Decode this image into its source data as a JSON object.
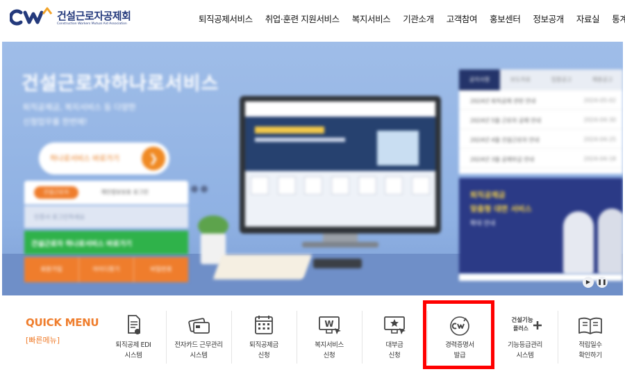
{
  "header": {
    "logo_text": "건설근로자공제회",
    "logo_sub": "Construction Workers Mutual Aid Association",
    "nav": [
      "퇴직공제서비스",
      "취업·훈련 지원서비스",
      "복지서비스",
      "기관소개",
      "고객참여",
      "홍보센터",
      "정보공개",
      "자료실",
      "통계"
    ]
  },
  "hero": {
    "title": "건설근로자하나로서비스",
    "desc_line1": "퇴직공제금, 복지서비스 등 다양한",
    "desc_line2": "신청업무를 한번에!",
    "pill_label": "하나로서비스 바로가기",
    "pill_arrow": "❯",
    "login_tab": "건설근로자",
    "login_option": "개인정보보호 로그인",
    "login_placeholder": "인증서 로그인하세요",
    "green_label": "건설근로자 하나로서비스 바로가기",
    "orange_buttons": [
      "회원가입",
      "아이디찾기",
      "비밀번호"
    ],
    "notice_tabs": [
      "공지사항",
      "보도자료",
      "입찰공고",
      "채용공고"
    ],
    "notices": [
      {
        "title": "2024년 퇴직공제 관련 안내",
        "date": "2024-05-02"
      },
      {
        "title": "2024년 5월 근로자 공제 안내",
        "date": "2024-04-30"
      },
      {
        "title": "2024년 4월 건설근로자 안내",
        "date": "2024-04-25"
      },
      {
        "title": "2024년 3월 공제부금 안내",
        "date": "2024-04-18"
      }
    ],
    "promo_line1": "퇴직공제금",
    "promo_line2": "맞춤형 대면 서비스",
    "promo_line3": "확대 안내",
    "play_icon": "▶",
    "pause_icon": "❚❚"
  },
  "quick_menu": {
    "title": "QUICK MENU",
    "subtitle": "[빠른메뉴]",
    "items": [
      {
        "line1": "퇴직공제 EDI",
        "line2": "시스템",
        "icon": "document-edit-icon"
      },
      {
        "line1": "전자카드 근무관리",
        "line2": "시스템",
        "icon": "card-icon"
      },
      {
        "line1": "퇴직공제금",
        "line2": "신청",
        "icon": "calendar-icon"
      },
      {
        "line1": "복지서비스",
        "line2": "신청",
        "icon": "welfare-icon"
      },
      {
        "line1": "대부금",
        "line2": "신청",
        "icon": "loan-icon"
      },
      {
        "line1": "경력증명서",
        "line2": "발급",
        "icon": "cw-logo-icon"
      },
      {
        "line1": "기능등급관리",
        "line2": "시스템",
        "icon": "skill-grade-icon",
        "badge_l1": "건설기능",
        "badge_l2": "플러스"
      },
      {
        "line1": "적립일수",
        "line2": "확인하기",
        "icon": "book-icon"
      }
    ]
  },
  "colors": {
    "brand_navy": "#243a7c",
    "accent_orange": "#ef7d2c",
    "highlight_red": "#ff0000"
  }
}
